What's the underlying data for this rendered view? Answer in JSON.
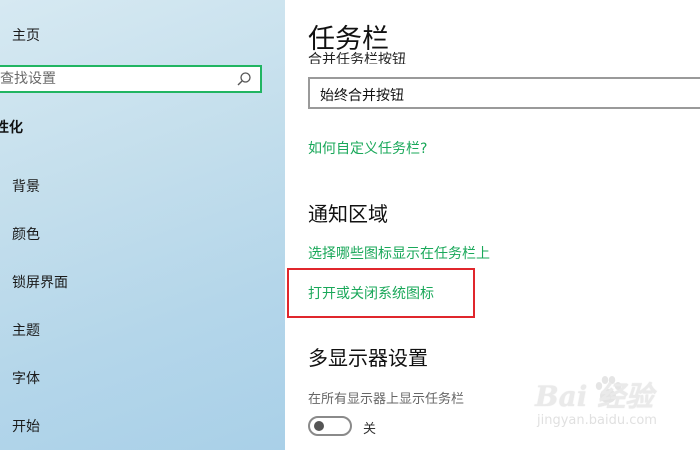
{
  "sidebar": {
    "home_label": "主页",
    "search_placeholder": "查找设置",
    "section_label": "性化",
    "items": [
      {
        "label": "背景"
      },
      {
        "label": "颜色"
      },
      {
        "label": "锁屏界面"
      },
      {
        "label": "主题"
      },
      {
        "label": "字体"
      },
      {
        "label": "开始"
      }
    ]
  },
  "main": {
    "title": "任务栏",
    "combine_label": "合并任务栏按钮",
    "combine_value": "始终合并按钮",
    "customize_link": "如何自定义任务栏?",
    "notification_heading": "通知区域",
    "select_icons_link": "选择哪些图标显示在任务栏上",
    "system_icons_link": "打开或关闭系统图标",
    "multi_display_heading": "多显示器设置",
    "show_all_displays_label": "在所有显示器上显示任务栏",
    "toggle_state": "关"
  },
  "watermark": {
    "brand": "Bai  经验",
    "url": "jingyan.baidu.com"
  },
  "colors": {
    "accent": "#1aa85a",
    "search_border": "#21b562",
    "highlight": "#e0262c",
    "sidebar_bg": "#b4d6ea"
  },
  "icons": {
    "search": "search-icon",
    "home": "home-icon"
  }
}
